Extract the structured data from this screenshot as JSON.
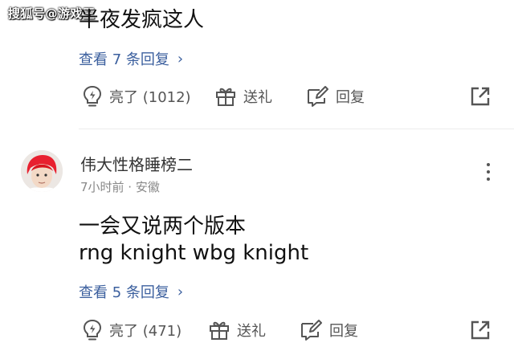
{
  "watermark": "搜狐号@游戏王",
  "comment1": {
    "text_partial": "半夜发疯这人",
    "view_replies": "查看 7 条回复",
    "actions": {
      "like": "亮了 (1012)",
      "gift": "送礼",
      "reply": "回复"
    }
  },
  "comment2": {
    "username": "伟大性格睡榜二",
    "meta": "7小时前 · 安徽",
    "line1": "一会又说两个版本",
    "line2": "rng knight wbg knight",
    "view_replies": "查看 5 条回复",
    "actions": {
      "like": "亮了 (471)",
      "gift": "送礼",
      "reply": "回复"
    }
  },
  "icons": [
    "lightbulb-icon",
    "gift-icon",
    "reply-edit-icon",
    "share-icon",
    "more-vertical-icon",
    "chevron-right-icon"
  ],
  "colors": {
    "link": "#3b5f9e",
    "secondary_text": "#555555",
    "meta_text": "#888888",
    "divider": "#ececec"
  }
}
